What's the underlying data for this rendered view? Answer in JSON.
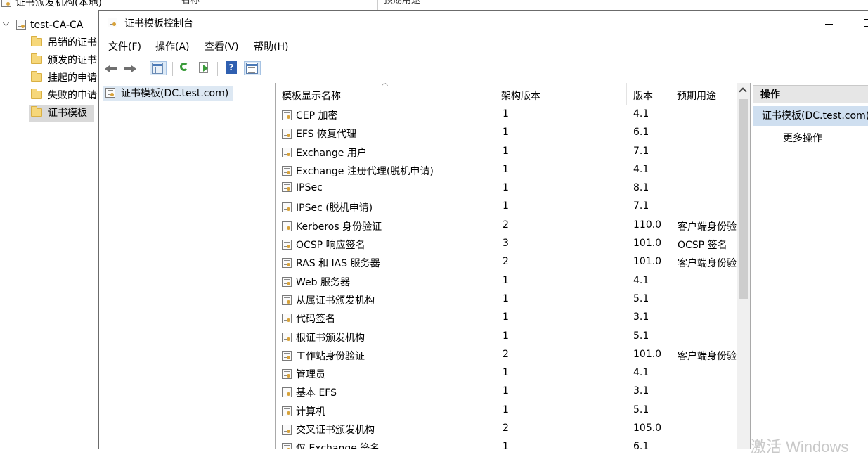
{
  "background": {
    "tree": {
      "root_label": "证书颁发机构(本地)",
      "ca_label": "test-CA-CA",
      "items": [
        {
          "label": "吊销的证书"
        },
        {
          "label": "颁发的证书"
        },
        {
          "label": "挂起的申请"
        },
        {
          "label": "失败的申请"
        },
        {
          "label": "证书模板"
        }
      ]
    },
    "list_headers": {
      "name": "名称",
      "purpose": "预期用途"
    }
  },
  "window": {
    "title": "证书模板控制台",
    "menu": [
      {
        "label": "文件(F)"
      },
      {
        "label": "操作(A)"
      },
      {
        "label": "查看(V)"
      },
      {
        "label": "帮助(H)"
      }
    ],
    "toolbar": {
      "icons": [
        "back-arrow-icon",
        "forward-arrow-icon",
        "show-hide-console-tree-icon",
        "refresh-icon",
        "export-list-icon",
        "help-icon",
        "properties-icon"
      ],
      "help_glyph": "?"
    },
    "tree": {
      "selected_label": "证书模板(DC.test.com)"
    },
    "list": {
      "columns": {
        "name": "模板显示名称",
        "schema": "架构版本",
        "version": "版本",
        "purpose": "预期用途"
      },
      "rows": [
        {
          "name": "CEP 加密",
          "schema": "1",
          "version": "4.1",
          "purpose": ""
        },
        {
          "name": "EFS 恢复代理",
          "schema": "1",
          "version": "6.1",
          "purpose": ""
        },
        {
          "name": "Exchange 用户",
          "schema": "1",
          "version": "7.1",
          "purpose": ""
        },
        {
          "name": "Exchange 注册代理(脱机申请)",
          "schema": "1",
          "version": "4.1",
          "purpose": ""
        },
        {
          "name": "IPSec",
          "schema": "1",
          "version": "8.1",
          "purpose": ""
        },
        {
          "name": "IPSec (脱机申请)",
          "schema": "1",
          "version": "7.1",
          "purpose": ""
        },
        {
          "name": "Kerberos 身份验证",
          "schema": "2",
          "version": "110.0",
          "purpose": "客户端身份验"
        },
        {
          "name": "OCSP 响应签名",
          "schema": "3",
          "version": "101.0",
          "purpose": "OCSP 签名"
        },
        {
          "name": "RAS 和 IAS 服务器",
          "schema": "2",
          "version": "101.0",
          "purpose": "客户端身份验"
        },
        {
          "name": "Web 服务器",
          "schema": "1",
          "version": "4.1",
          "purpose": ""
        },
        {
          "name": "从属证书颁发机构",
          "schema": "1",
          "version": "5.1",
          "purpose": ""
        },
        {
          "name": "代码签名",
          "schema": "1",
          "version": "3.1",
          "purpose": ""
        },
        {
          "name": "根证书颁发机构",
          "schema": "1",
          "version": "5.1",
          "purpose": ""
        },
        {
          "name": "工作站身份验证",
          "schema": "2",
          "version": "101.0",
          "purpose": "客户端身份验"
        },
        {
          "name": "管理员",
          "schema": "1",
          "version": "4.1",
          "purpose": ""
        },
        {
          "name": "基本 EFS",
          "schema": "1",
          "version": "3.1",
          "purpose": ""
        },
        {
          "name": "计算机",
          "schema": "1",
          "version": "5.1",
          "purpose": ""
        },
        {
          "name": "交叉证书颁发机构",
          "schema": "2",
          "version": "105.0",
          "purpose": ""
        },
        {
          "name": "仅 Exchange 签名",
          "schema": "1",
          "version": "6.1",
          "purpose": ""
        }
      ]
    },
    "actions": {
      "header": "操作",
      "subheader": "证书模板(DC.test.com)",
      "more": "更多操作"
    }
  },
  "watermark": "激活 Windows"
}
